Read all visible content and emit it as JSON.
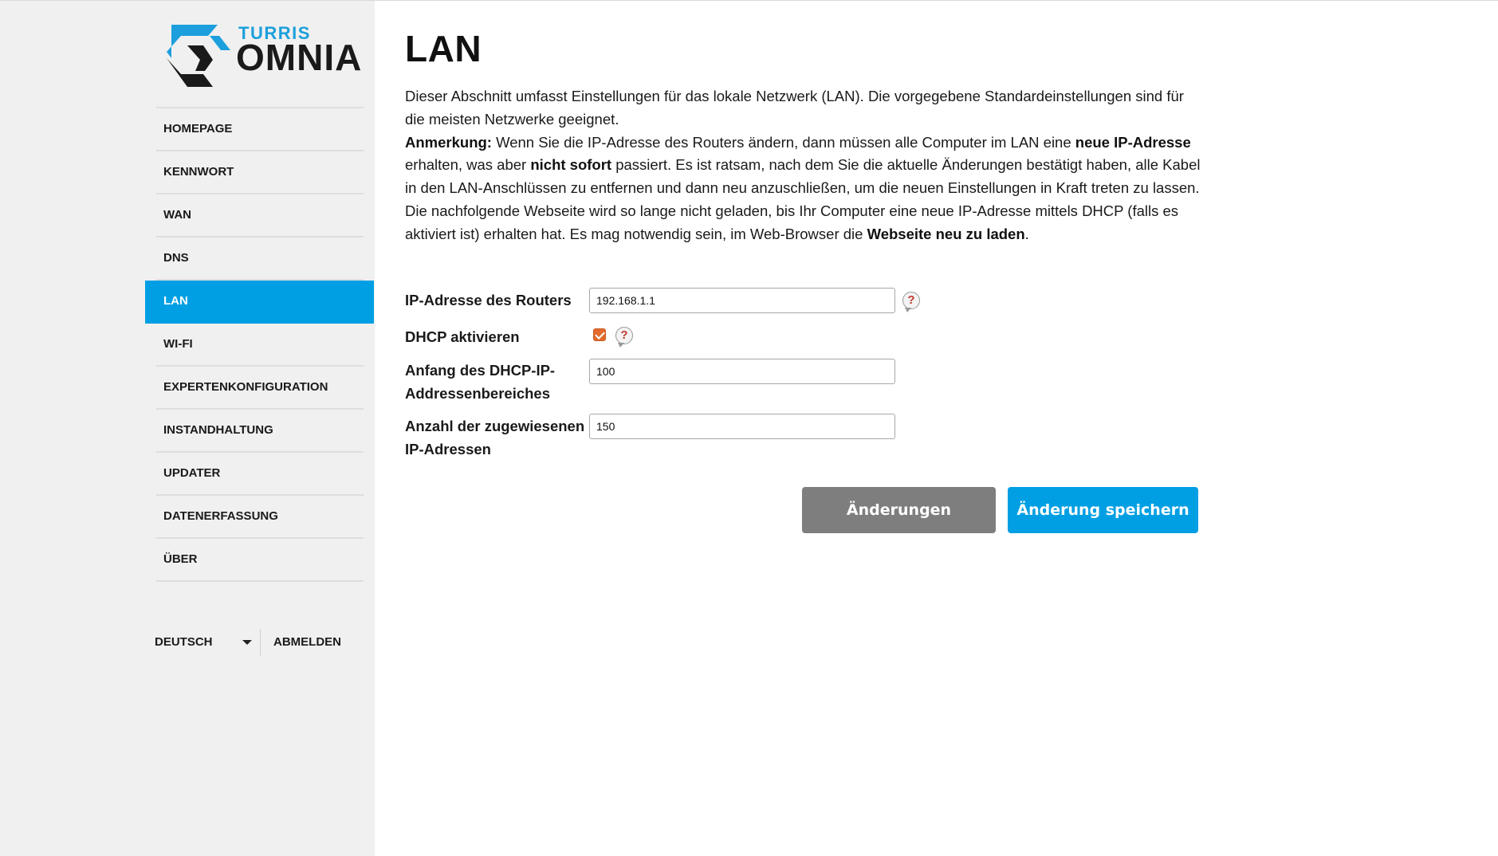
{
  "brand": {
    "line1": "TURRIS",
    "line2": "OMNIA",
    "accent": "#009fe3"
  },
  "sidebar": {
    "items": [
      {
        "label": "HOMEPAGE",
        "active": false
      },
      {
        "label": "KENNWORT",
        "active": false
      },
      {
        "label": "WAN",
        "active": false
      },
      {
        "label": "DNS",
        "active": false
      },
      {
        "label": "LAN",
        "active": true
      },
      {
        "label": "WI-FI",
        "active": false
      },
      {
        "label": "EXPERTENKONFIGURATION",
        "active": false
      },
      {
        "label": "INSTANDHALTUNG",
        "active": false
      },
      {
        "label": "UPDATER",
        "active": false
      },
      {
        "label": "DATENERFASSUNG",
        "active": false
      },
      {
        "label": "ÜBER",
        "active": false
      }
    ],
    "language": "DEUTSCH",
    "logout": "ABMELDEN"
  },
  "page": {
    "title": "LAN",
    "intro_1": "Dieser Abschnitt umfasst Einstellungen für das lokale Netzwerk (LAN). Die vorgegebene Standardeinstellungen sind für die meisten Netzwerke geeignet.",
    "note_label": "Anmerkung:",
    "note_a": " Wenn Sie die IP-Adresse des Routers ändern, dann müssen alle Computer im LAN eine ",
    "note_b": "neue IP-Adresse",
    "note_c": " erhalten, was aber ",
    "note_d": "nicht sofort",
    "note_e": " passiert. Es ist ratsam, nach dem Sie die aktuelle Änderungen bestätigt haben, alle Kabel in den LAN-Anschlüssen zu entfernen und dann neu anzuschließen, um die neuen Einstellungen in Kraft treten zu lassen. Die nachfolgende Webseite wird so lange nicht geladen, bis Ihr Computer eine neue IP-Adresse mittels DHCP (falls es aktiviert ist) erhalten hat. Es mag notwendig sein, im Web-Browser die ",
    "note_f": "Webseite neu zu laden",
    "note_g": "."
  },
  "form": {
    "router_ip_label": "IP-Adresse des Routers",
    "router_ip_value": "192.168.1.1",
    "dhcp_label": "DHCP aktivieren",
    "dhcp_enabled": true,
    "dhcp_start_label_1": "Anfang des DHCP-IP-",
    "dhcp_start_label_2": "Addressenbereiches",
    "dhcp_start_value": "100",
    "dhcp_count_label_1": "Anzahl der zugewiesenen",
    "dhcp_count_label_2": "IP-Adressen",
    "dhcp_count_value": "150",
    "help_glyph": "?"
  },
  "buttons": {
    "discard": "Änderungen verwerfen",
    "save": "Änderung speichern"
  }
}
